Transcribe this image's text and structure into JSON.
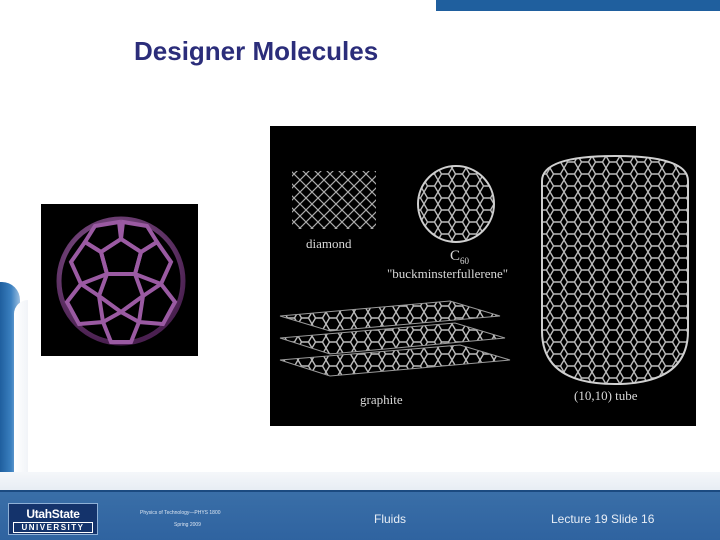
{
  "slide": {
    "title": "Designer Molecules"
  },
  "figure": {
    "labels": {
      "diamond": "diamond",
      "c60": "C",
      "c60_sub": "60",
      "buckminsterfullerene": "\"buckminsterfullerene\"",
      "graphite": "graphite",
      "tube": "(10,10) tube"
    }
  },
  "footer": {
    "logo_top": "UtahState",
    "logo_bottom": "UNIVERSITY",
    "course": "Physics of Technology—PHYS 1800",
    "term": "Spring 2009",
    "topic": "Fluids",
    "lecture": "Lecture 19   Slide 16"
  },
  "colors": {
    "title": "#2b2d7a",
    "footer_bg": "#2f63a0",
    "accent_blue": "#1f5f9e",
    "c60_purple": "#8a4a8f"
  }
}
